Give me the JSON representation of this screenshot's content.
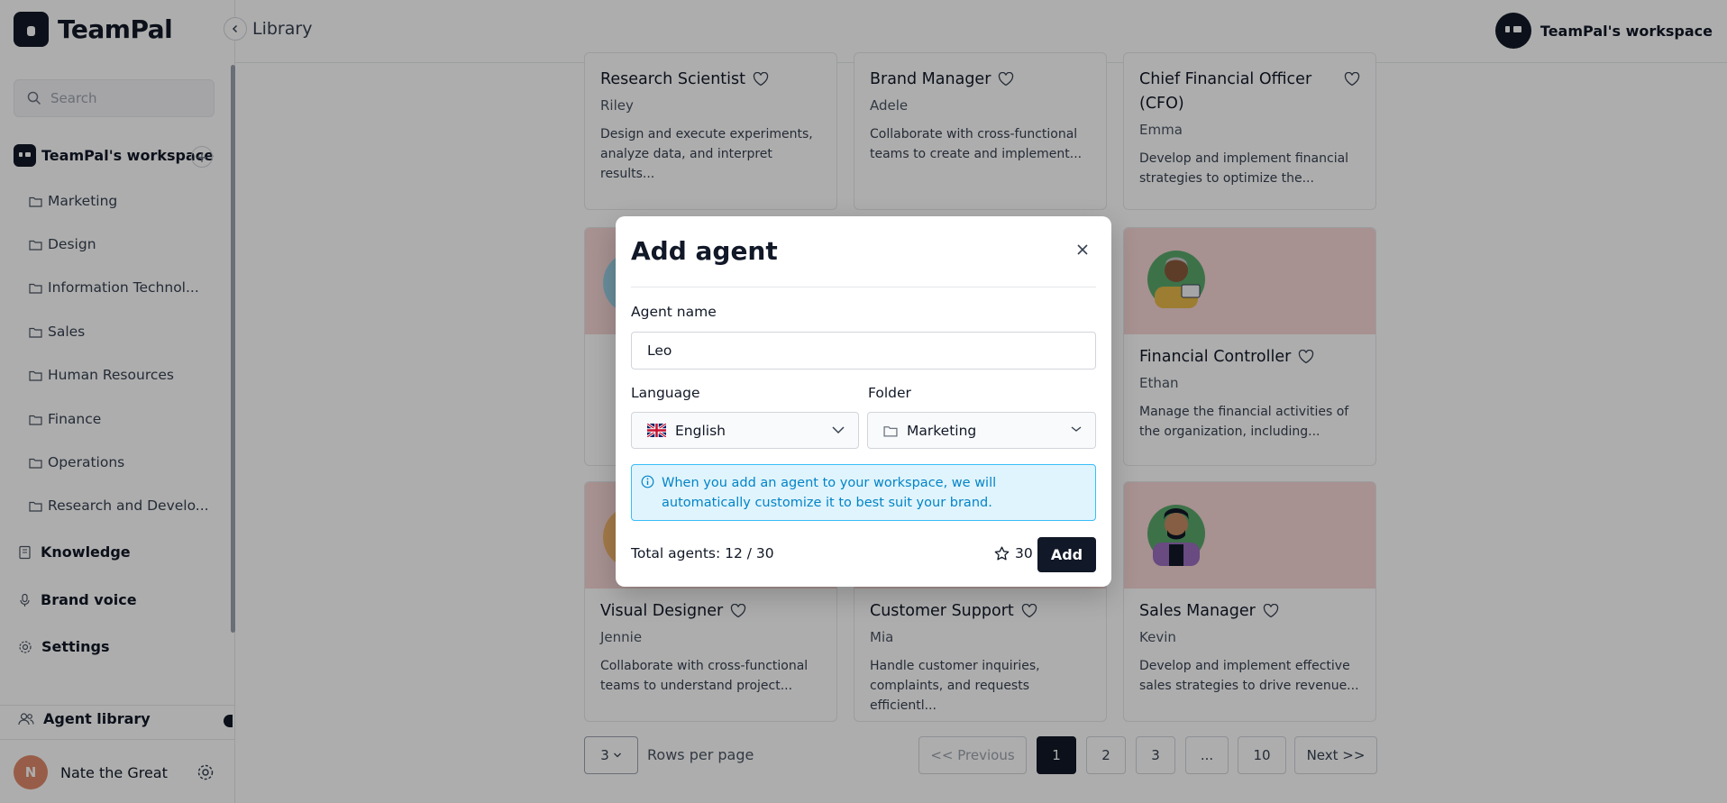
{
  "app": {
    "name": "TeamPal"
  },
  "topbar": {
    "breadcrumb": "Library",
    "workspace": "TeamPal's workspace"
  },
  "sidebar": {
    "search_placeholder": "Search",
    "workspace": "TeamPal's workspace",
    "folders": [
      "Marketing",
      "Design",
      "Information Technol...",
      "Sales",
      "Human Resources",
      "Finance",
      "Operations",
      "Research and Develo..."
    ],
    "nav": {
      "knowledge": "Knowledge",
      "brand_voice": "Brand voice",
      "settings": "Settings",
      "agent_library": "Agent library"
    },
    "user": {
      "initial": "N",
      "name": "Nate the Great"
    }
  },
  "cards": [
    {
      "title": "Research Scientist",
      "name": "Riley",
      "desc": "Design and execute experiments, analyze data, and interpret results..."
    },
    {
      "title": "Brand Manager",
      "name": "Adele",
      "desc": "Collaborate with cross-functional teams to create and implement..."
    },
    {
      "title": "Chief Financial Officer (CFO)",
      "name": "Emma",
      "desc": "Develop and implement financial strategies to optimize the..."
    },
    {
      "title": "Financial Controller",
      "name": "Ethan",
      "desc": "Manage the financial activities of the organization, including..."
    },
    {
      "title": "Visual Designer",
      "name": "Jennie",
      "desc": "Collaborate with cross-functional teams to understand project..."
    },
    {
      "title": "Customer Support",
      "name": "Mia",
      "desc": "Handle customer inquiries, complaints, and requests efficientl..."
    },
    {
      "title": "Sales Manager",
      "name": "Kevin",
      "desc": "Develop and implement effective sales strategies to drive revenue..."
    }
  ],
  "pagination": {
    "rows_value": "3",
    "rows_label": "Rows per page",
    "previous": "<< Previous",
    "pages": [
      "1",
      "2",
      "3",
      "...",
      "10"
    ],
    "next": "Next >>"
  },
  "modal": {
    "title": "Add agent",
    "agent_name_label": "Agent name",
    "agent_name_value": "Leo",
    "language_label": "Language",
    "language_value": "English",
    "folder_label": "Folder",
    "folder_value": "Marketing",
    "info": "When you add an agent to your workspace, we will automatically customize it to best suit your brand.",
    "total": "Total agents: 12 / 30",
    "credits": "30",
    "add": "Add"
  },
  "colors": {
    "accent": "#111827",
    "info_bg": "#e0f4fd",
    "info_border": "#38bdf8",
    "info_text": "#0284c7",
    "card_pink": "#f7d6d6"
  }
}
